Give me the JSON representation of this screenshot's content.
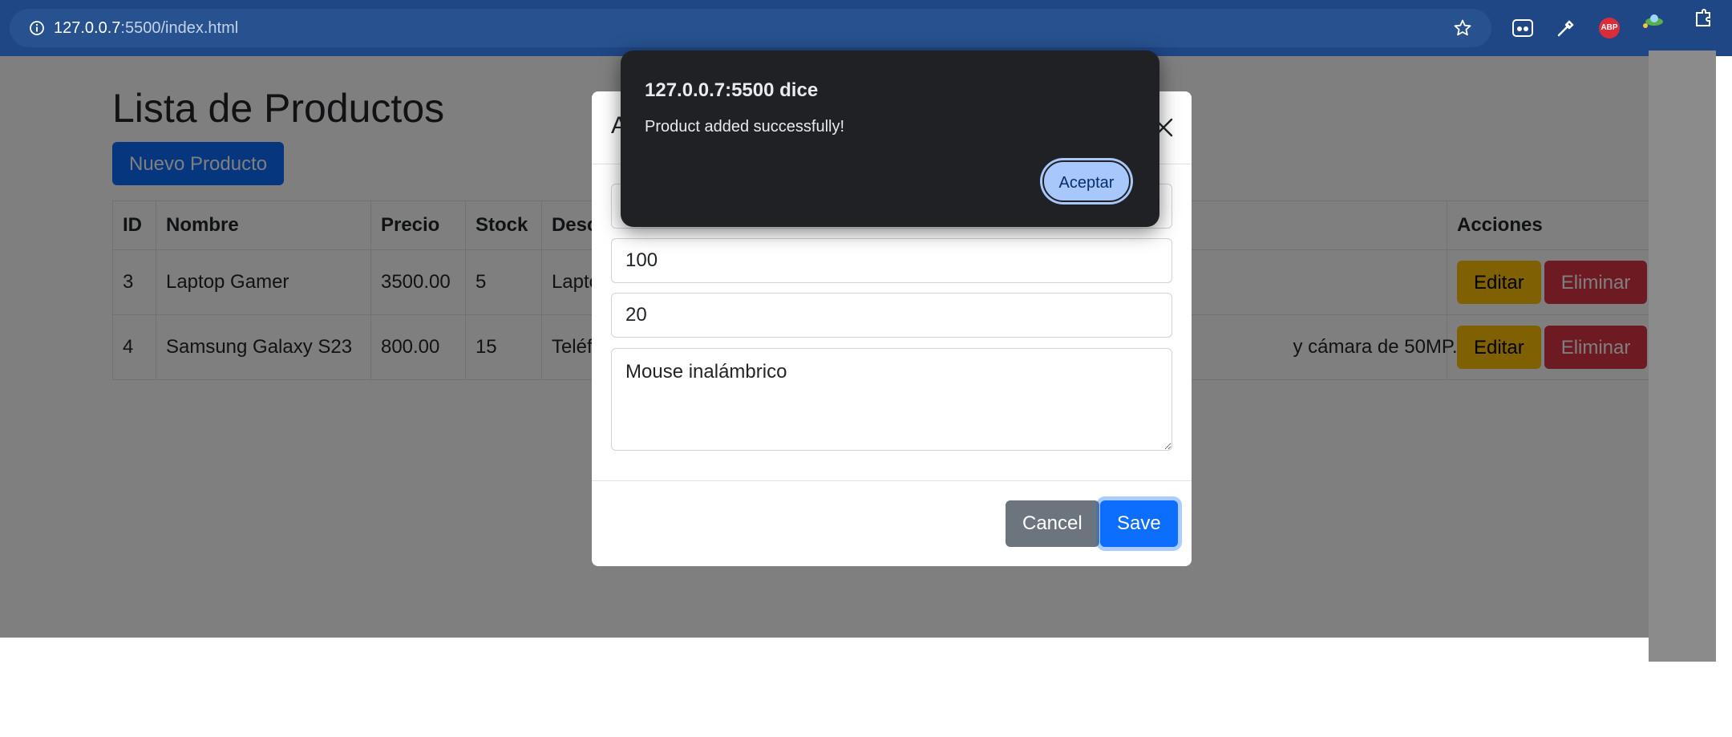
{
  "browser": {
    "url_host": "127.0.0.7",
    "url_rest": ":5500/index.html",
    "extensions": [
      "reader-icon",
      "eyedropper-icon",
      "adblock-plus-icon",
      "extension-ufo-icon",
      "extensions-puzzle-icon"
    ],
    "abp_label": "ABP"
  },
  "page": {
    "title": "Lista de Productos",
    "new_button": "Nuevo Producto",
    "table": {
      "headers": [
        "ID",
        "Nombre",
        "Precio",
        "Stock",
        "Desc",
        "Acciones"
      ],
      "rows": [
        {
          "id": "3",
          "name": "Laptop Gamer",
          "price": "3500.00",
          "stock": "5",
          "desc": "Lapto",
          "desc_end": ""
        },
        {
          "id": "4",
          "name": "Samsung Galaxy S23",
          "price": "800.00",
          "stock": "15",
          "desc": "Teléf",
          "desc_end": "y cámara de 50MP."
        }
      ],
      "edit_label": "Editar",
      "delete_label": "Eliminar"
    }
  },
  "modal": {
    "title_visible": "A",
    "fields": {
      "price": "100",
      "stock": "20",
      "description": "Mouse inalámbrico"
    },
    "cancel_label": "Cancel",
    "save_label": "Save"
  },
  "alert": {
    "title": "127.0.0.7:5500 dice",
    "message": "Product added successfully!",
    "accept_label": "Aceptar"
  },
  "colors": {
    "chrome_bar": "#1f4685",
    "primary": "#0d6efd",
    "warning": "#ffc107",
    "danger": "#dc3545",
    "secondary": "#6c757d",
    "alert_bg": "#202124",
    "alert_button": "#a8c7fa"
  }
}
